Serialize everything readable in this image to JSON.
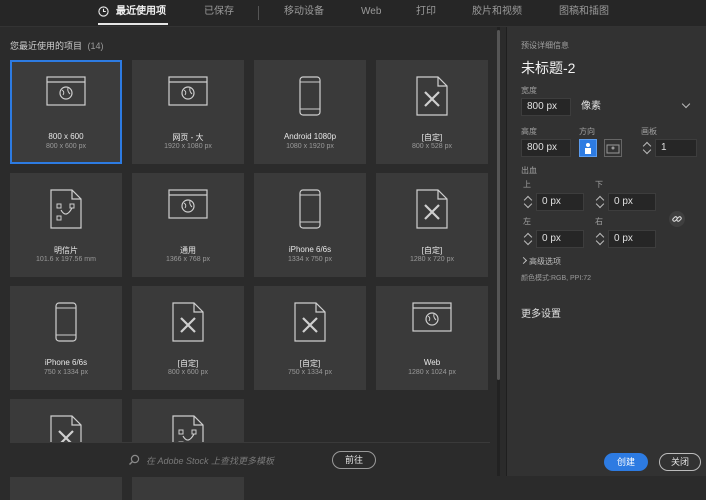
{
  "tabs": [
    {
      "label": "最近使用项",
      "active": true
    },
    {
      "label": "已保存"
    },
    {
      "label": "移动设备"
    },
    {
      "label": "Web"
    },
    {
      "label": "打印"
    },
    {
      "label": "胶片和视频"
    },
    {
      "label": "图稿和插图"
    }
  ],
  "recent": {
    "title": "您最近使用的项目",
    "count": "(14)"
  },
  "presets": [
    {
      "name": "800 x 600",
      "size": "800 x 600 px",
      "icon": "web-page-icon",
      "selected": true
    },
    {
      "name": "网页 - 大",
      "size": "1920 x 1080 px",
      "icon": "web-page-icon"
    },
    {
      "name": "Android 1080p",
      "size": "1080 x 1920 px",
      "icon": "phone-icon"
    },
    {
      "name": "[自定]",
      "size": "800 x 528 px",
      "icon": "custom-doc-icon"
    },
    {
      "name": "明信片",
      "size": "101.6 x 197.56 mm",
      "icon": "postcard-icon"
    },
    {
      "name": "通用",
      "size": "1366 x 768 px",
      "icon": "web-page-icon"
    },
    {
      "name": "iPhone 6/6s",
      "size": "1334 x 750 px",
      "icon": "phone-icon"
    },
    {
      "name": "[自定]",
      "size": "1280 x 720 px",
      "icon": "custom-doc-icon"
    },
    {
      "name": "iPhone 6/6s",
      "size": "750 x 1334 px",
      "icon": "phone-icon"
    },
    {
      "name": "[自定]",
      "size": "800 x 600 px",
      "icon": "custom-doc-icon"
    },
    {
      "name": "[自定]",
      "size": "750 x 1334 px",
      "icon": "custom-doc-icon"
    },
    {
      "name": "Web",
      "size": "1280 x 1024 px",
      "icon": "web-page-icon"
    },
    {
      "name": "",
      "size": "",
      "icon": "custom-doc-icon"
    },
    {
      "name": "",
      "size": "",
      "icon": "postcard-icon"
    }
  ],
  "search": {
    "placeholder": "在 Adobe Stock 上查找更多模板",
    "go": "前往"
  },
  "panel": {
    "header": "预设详细信息",
    "doc_title": "未标题-2",
    "width_label": "宽度",
    "width_value": "800 px",
    "unit": "像素",
    "height_label": "高度",
    "height_value": "800 px",
    "orientation_label": "方向",
    "artboards_label": "画板",
    "artboards_value": "1",
    "bleed_label": "出血",
    "top_label": "上",
    "bottom_label": "下",
    "left_label": "左",
    "right_label": "右",
    "bleed_top": "0 px",
    "bleed_bottom": "0 px",
    "bleed_left": "0 px",
    "bleed_right": "0 px",
    "advanced": "高级选项",
    "color_mode": "颜色模式:RGB, PPI:72",
    "more_settings": "更多设置",
    "create": "创建",
    "close": "关闭"
  },
  "colors": {
    "accent": "#2d7be2",
    "background": "#2b2b2b",
    "card": "#3a3a3a"
  }
}
